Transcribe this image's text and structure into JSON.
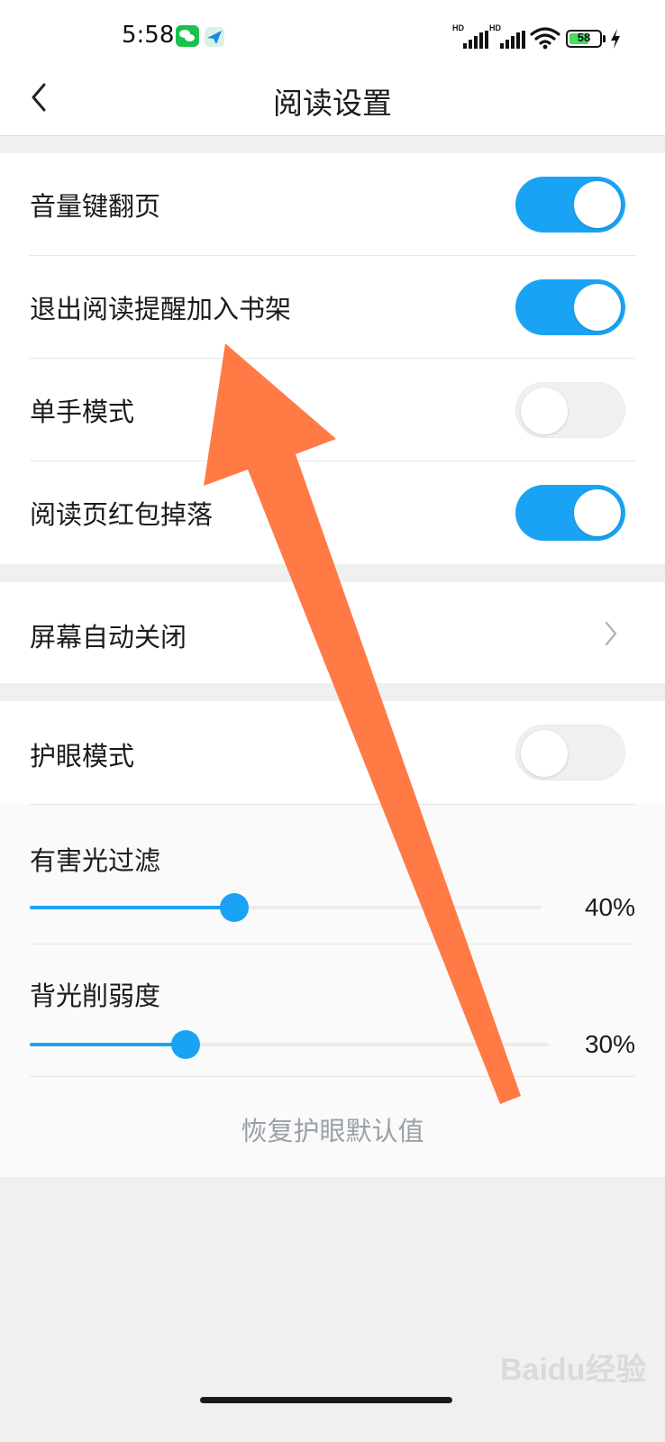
{
  "status_bar": {
    "time": "5:58",
    "battery_level": "58",
    "signal_labels": [
      "HD",
      "HD"
    ],
    "icons": [
      "wechat-icon",
      "send-icon",
      "signal-icon",
      "wifi-icon",
      "battery-icon",
      "charging-icon"
    ]
  },
  "header": {
    "title": "阅读设置",
    "back_icon": "chevron-left-icon"
  },
  "reading_settings": {
    "items": [
      {
        "label": "音量键翻页",
        "enabled": true
      },
      {
        "label": "退出阅读提醒加入书架",
        "enabled": true
      },
      {
        "label": "单手模式",
        "enabled": false
      },
      {
        "label": "阅读页红包掉落",
        "enabled": true
      }
    ]
  },
  "screen_auto_off": {
    "label": "屏幕自动关闭",
    "icon": "chevron-right-icon"
  },
  "eye_protection": {
    "mode": {
      "label": "护眼模式",
      "enabled": false
    },
    "harmful_light_filter": {
      "label": "有害光过滤",
      "value": 40,
      "value_text": "40%"
    },
    "backlight_reduction": {
      "label": "背光削弱度",
      "value": 30,
      "value_text": "30%"
    },
    "restore_label": "恢复护眼默认值"
  },
  "watermark": {
    "text": "Baidu经验"
  },
  "colors": {
    "accent": "#1aa3f5",
    "annotation_arrow": "#ff7a45",
    "toggle_off": "#f0f0f0",
    "page_background": "#f0f0f0"
  }
}
